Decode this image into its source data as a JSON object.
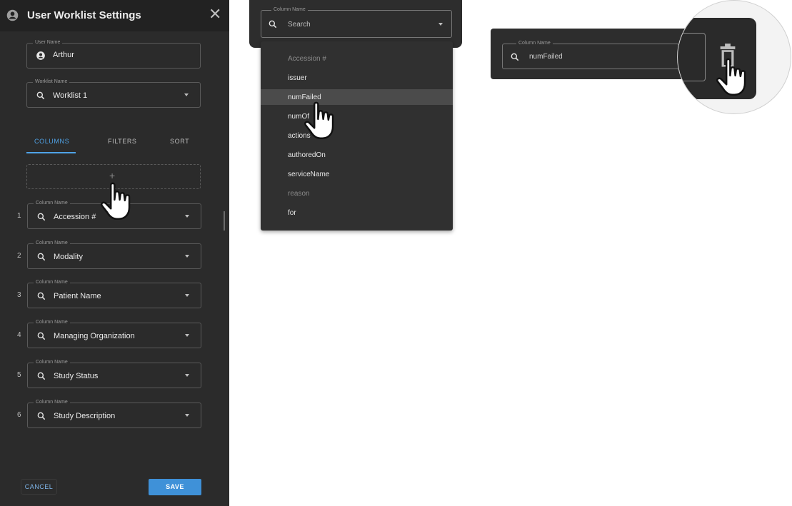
{
  "dialog": {
    "title": "User Worklist Settings",
    "close_glyph": "✕",
    "user_field": {
      "legend": "User Name",
      "value": "Arthur",
      "icon": "account-circle-icon"
    },
    "worklist_field": {
      "legend": "Worklist Name",
      "value": "Worklist 1",
      "icon": "search-icon"
    },
    "tabs": [
      {
        "label": "COLUMNS",
        "active": true
      },
      {
        "label": "FILTERS",
        "active": false
      },
      {
        "label": "SORT",
        "active": false
      }
    ],
    "add_column_glyph": "+",
    "columns": [
      {
        "index": "1",
        "legend": "Column Name",
        "value": "Accession #"
      },
      {
        "index": "2",
        "legend": "Column Name",
        "value": "Modality"
      },
      {
        "index": "3",
        "legend": "Column Name",
        "value": "Patient Name"
      },
      {
        "index": "4",
        "legend": "Column Name",
        "value": "Managing Organization"
      },
      {
        "index": "5",
        "legend": "Column Name",
        "value": "Study Status"
      },
      {
        "index": "6",
        "legend": "Column Name",
        "value": "Study Description"
      }
    ],
    "cancel_label": "CANCEL",
    "save_label": "SAVE"
  },
  "search_example": {
    "legend": "Column Name",
    "placeholder": "Search",
    "options": [
      {
        "label": "Accession #",
        "disabled": true
      },
      {
        "label": "issuer",
        "disabled": false
      },
      {
        "label": "numFailed",
        "disabled": false,
        "highlighted": true
      },
      {
        "label": "numOf",
        "disabled": false
      },
      {
        "label": "actions",
        "disabled": false
      },
      {
        "label": "authoredOn",
        "disabled": false
      },
      {
        "label": "serviceName",
        "disabled": false
      },
      {
        "label": "reason",
        "disabled": true
      },
      {
        "label": "for",
        "disabled": false
      }
    ]
  },
  "delete_example": {
    "legend": "Column Name",
    "value": "numFailed",
    "delete_icon": "trash-icon"
  },
  "colors": {
    "accent": "#4fa3e8",
    "panel": "#2b2b2b",
    "save": "#3f91d8"
  }
}
